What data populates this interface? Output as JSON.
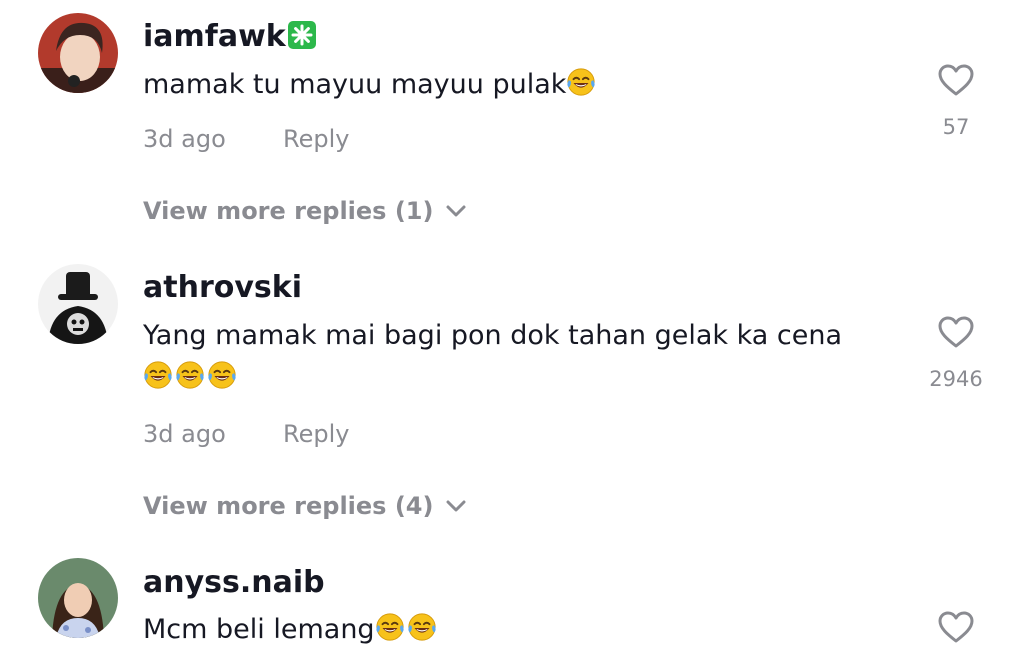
{
  "comments": [
    {
      "username": "iamfawk",
      "badge_icon": "sparkle-badge-icon",
      "text": "mamak tu mayuu mayuu pulak",
      "emoji_icon": "face-with-tears-of-joy-icon",
      "emoji_count": 1,
      "time": "3d ago",
      "reply_label": "Reply",
      "likes": "57",
      "view_more": "View more replies (1)"
    },
    {
      "username": "athrovski",
      "text": "Yang mamak mai bagi pon dok tahan gelak ka cena",
      "emoji_icon": "face-with-tears-of-joy-icon",
      "emoji_count": 3,
      "time": "3d ago",
      "reply_label": "Reply",
      "likes": "2946",
      "view_more": "View more replies (4)"
    },
    {
      "username": "anyss.naib",
      "text": "Mcm beli lemang",
      "emoji_icon": "face-with-tears-of-joy-icon",
      "emoji_count": 2
    }
  ],
  "colors": {
    "primary_text": "#161823",
    "secondary_text": "#8a8b91",
    "badge_green": "#2cb84b",
    "like_icon": "#8a8b91"
  }
}
